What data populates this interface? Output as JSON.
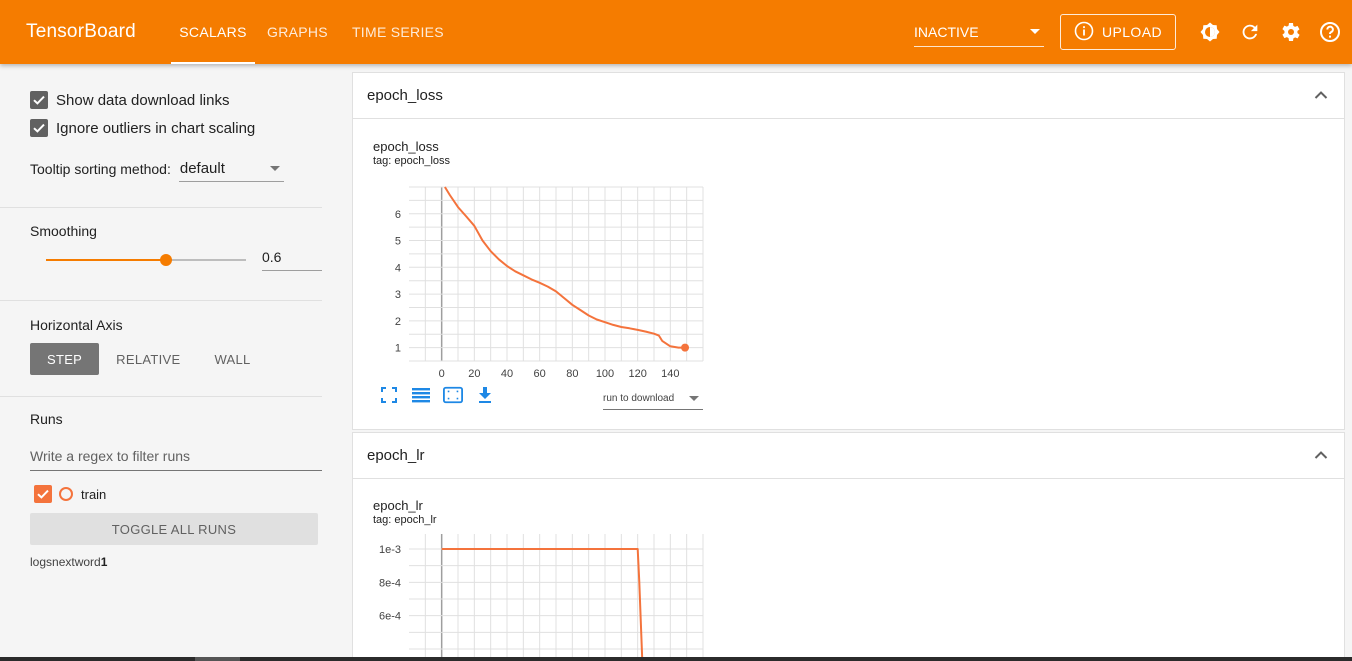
{
  "header": {
    "brand": "TensorBoard",
    "tabs": [
      {
        "label": "SCALARS",
        "active": true
      },
      {
        "label": "GRAPHS",
        "active": false
      },
      {
        "label": "TIME SERIES",
        "active": false
      }
    ],
    "run_status": "INACTIVE",
    "upload_label": "UPLOAD",
    "icons": [
      "info-icon",
      "theme-toggle-icon",
      "refresh-icon",
      "settings-icon",
      "help-icon"
    ],
    "accent_color": "#f57c00"
  },
  "sidebar": {
    "show_download_links": {
      "label": "Show data download links",
      "checked": true
    },
    "ignore_outliers": {
      "label": "Ignore outliers in chart scaling",
      "checked": true
    },
    "tooltip_sorting": {
      "label": "Tooltip sorting method:",
      "value": "default"
    },
    "smoothing": {
      "label": "Smoothing",
      "value": "0.6",
      "fraction": 0.6
    },
    "horizontal_axis": {
      "label": "Horizontal Axis",
      "options": [
        "STEP",
        "RELATIVE",
        "WALL"
      ],
      "selected": "STEP"
    },
    "runs": {
      "label": "Runs",
      "filter_placeholder": "Write a regex to filter runs",
      "items": [
        {
          "name": "train",
          "checked": true,
          "color": "#f4733c"
        }
      ],
      "toggle_label": "TOGGLE ALL RUNS",
      "logdir_prefix": "logsnextword",
      "logdir_suffix": "1"
    }
  },
  "main": {
    "cards": [
      {
        "header": "epoch_loss",
        "chart_title": "epoch_loss",
        "tag": "tag: epoch_loss",
        "download_select": "run to download"
      },
      {
        "header": "epoch_lr",
        "chart_title": "epoch_lr",
        "tag": "tag: epoch_lr"
      }
    ]
  },
  "chart_data": [
    {
      "type": "line",
      "title": "epoch_loss",
      "series": [
        {
          "name": "train",
          "color": "#f4733c",
          "x": [
            2,
            5,
            10,
            15,
            20,
            25,
            30,
            35,
            40,
            45,
            50,
            55,
            60,
            65,
            70,
            75,
            80,
            85,
            90,
            95,
            100,
            105,
            110,
            115,
            120,
            125,
            130,
            133,
            135,
            140,
            145,
            149
          ],
          "y": [
            7.0,
            6.7,
            6.25,
            5.9,
            5.55,
            5.0,
            4.6,
            4.3,
            4.05,
            3.85,
            3.7,
            3.55,
            3.42,
            3.28,
            3.1,
            2.85,
            2.6,
            2.4,
            2.2,
            2.05,
            1.95,
            1.85,
            1.77,
            1.72,
            1.66,
            1.6,
            1.52,
            1.45,
            1.25,
            1.05,
            1.0,
            1.0
          ]
        }
      ],
      "xticks": [
        0,
        20,
        40,
        60,
        80,
        100,
        120,
        140
      ],
      "yticks": [
        1,
        2,
        3,
        4,
        5,
        6
      ],
      "xlim": [
        -20,
        160
      ],
      "ylim": [
        0.5,
        7.0
      ],
      "grid": true
    },
    {
      "type": "line",
      "title": "epoch_lr",
      "series": [
        {
          "name": "train",
          "color": "#f4733c",
          "x": [
            0,
            60,
            120,
            121,
            123
          ],
          "y": [
            0.001,
            0.001,
            0.001,
            0.0008,
            0.00028
          ]
        }
      ],
      "ytick_labels": [
        "1e-3",
        "8e-4",
        "6e-4"
      ],
      "yticks": [
        0.001,
        0.0008,
        0.0006
      ],
      "xlim": [
        -20,
        160
      ],
      "ylim": [
        0.00028,
        0.00109
      ],
      "grid": true
    }
  ]
}
